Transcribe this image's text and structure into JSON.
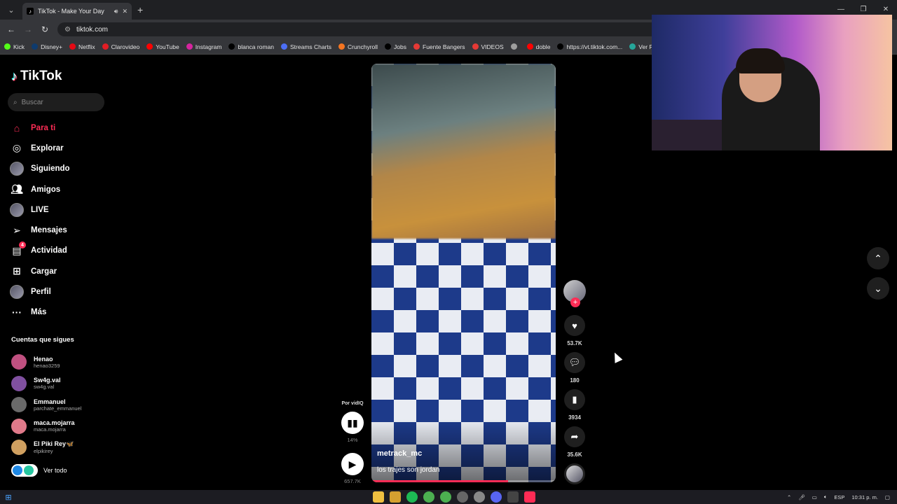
{
  "browser": {
    "tab_title": "TikTok - Make Your Day",
    "url": "tiktok.com",
    "bookmarks": [
      {
        "label": "Kick",
        "color": "#53fc18"
      },
      {
        "label": "Disney+",
        "color": "#0e3b6e"
      },
      {
        "label": "Netflix",
        "color": "#e50914"
      },
      {
        "label": "Clarovideo",
        "color": "#e21d24"
      },
      {
        "label": "YouTube",
        "color": "#ff0000"
      },
      {
        "label": "Instagram",
        "color": "#d6249f"
      },
      {
        "label": "blanca roman",
        "color": "#000000"
      },
      {
        "label": "Streams Charts",
        "color": "#4c6ef5"
      },
      {
        "label": "Crunchyroll",
        "color": "#f47521"
      },
      {
        "label": "Jobs",
        "color": "#000000"
      },
      {
        "label": "Fuente Bangers",
        "color": "#e53935"
      },
      {
        "label": "VIDEOS",
        "color": "#e53935"
      },
      {
        "label": "",
        "color": "#9e9e9e"
      },
      {
        "label": "doble",
        "color": "#ff0000"
      },
      {
        "label": "https://vt.tiktok.com...",
        "color": "#000000"
      },
      {
        "label": "Ver Pa",
        "color": "#26a69a"
      }
    ]
  },
  "tiktok": {
    "logo": "TikTok",
    "search_placeholder": "Buscar",
    "nav": [
      {
        "label": "Para ti",
        "icon": "home-icon",
        "active": true
      },
      {
        "label": "Explorar",
        "icon": "compass-icon"
      },
      {
        "label": "Siguiendo",
        "icon": "following-avatar"
      },
      {
        "label": "Amigos",
        "icon": "friends-icon"
      },
      {
        "label": "LIVE",
        "icon": "live-avatar"
      },
      {
        "label": "Mensajes",
        "icon": "send-icon"
      },
      {
        "label": "Actividad",
        "icon": "activity-icon",
        "badge": "4"
      },
      {
        "label": "Cargar",
        "icon": "upload-icon"
      },
      {
        "label": "Perfil",
        "icon": "profile-avatar"
      },
      {
        "label": "Más",
        "icon": "more-icon"
      }
    ],
    "following_title": "Cuentas que sigues",
    "following": [
      {
        "name": "Henao",
        "user": "henao3259",
        "color": "#c05080"
      },
      {
        "name": "Sw4g.val",
        "user": "sw4g.val",
        "color": "#8050a0"
      },
      {
        "name": "Emmanuel",
        "user": "parchate_emmanuel",
        "color": "#6a6a6a"
      },
      {
        "name": "maca.mojarra",
        "user": "maca.mojarra",
        "color": "#e07a8a"
      },
      {
        "name": "El Piki Rey🦋",
        "user": "elpikirey",
        "color": "#d0a060"
      }
    ],
    "see_all": "Ver todo"
  },
  "video": {
    "author": "metrack_mc",
    "caption": "los trajes son jordan",
    "progress": 0.74
  },
  "actions": {
    "likes": "53.7K",
    "comments": "180",
    "saves": "3934",
    "shares": "35.6K"
  },
  "vidiq": {
    "by": "Por vidIQ",
    "percent": "14%",
    "views": "657.7K"
  },
  "taskbar": {
    "lang": "ESP",
    "time": "10:31 p. m."
  }
}
